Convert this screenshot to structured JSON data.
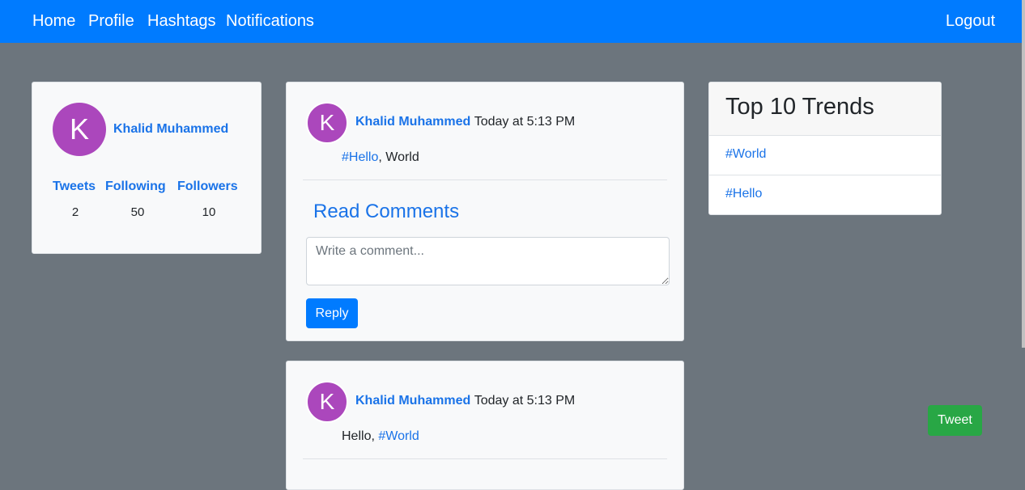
{
  "nav": {
    "home": "Home",
    "profile": "Profile",
    "hashtags": "Hashtags",
    "notifications": "Notifications",
    "logout": "Logout"
  },
  "profile": {
    "avatar_letter": "K",
    "name": "Khalid Muhammed",
    "tweets_label": "Tweets",
    "following_label": "Following",
    "followers_label": "Followers",
    "tweets": "2",
    "following": "50",
    "followers": "10"
  },
  "tweets": [
    {
      "avatar_letter": "K",
      "author": "Khalid Muhammed",
      "time": "Today at 5:13 PM",
      "hashtag": "#Hello",
      "text_after": ", World",
      "read_comments": "Read Comments",
      "comment_placeholder": "Write a comment...",
      "reply_label": "Reply"
    },
    {
      "avatar_letter": "K",
      "author": "Khalid Muhammed",
      "time": "Today at 5:13 PM",
      "text_before": "Hello, ",
      "hashtag": "#World"
    }
  ],
  "trends": {
    "title": "Top 10 Trends",
    "items": [
      "#World",
      "#Hello"
    ]
  },
  "tweet_button": "Tweet",
  "colors": {
    "navbar": "#007bff",
    "background": "#6c757d",
    "avatar": "#ab47bc",
    "link": "#1a73e8",
    "tweet_button": "#28a745"
  }
}
